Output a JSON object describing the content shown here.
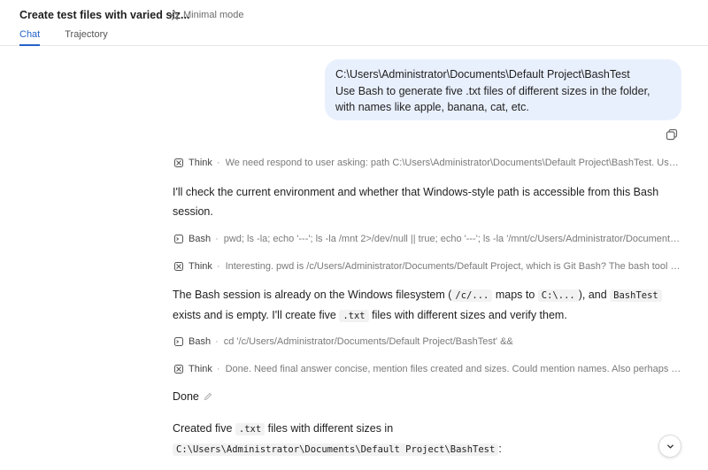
{
  "header": {
    "title": "Create test files with varied siz...",
    "minimal_mode": "Minimal mode",
    "tabs": [
      {
        "label": "Chat",
        "active": true
      },
      {
        "label": "Trajectory",
        "active": false
      }
    ]
  },
  "user_message": {
    "line1": "C:\\Users\\Administrator\\Documents\\Default Project\\BashTest",
    "line2": "Use Bash to generate five .txt files of different sizes in the folder, with names like apple, banana, cat, etc."
  },
  "steps": [
    {
      "kind": "Think",
      "text": "We need respond to user asking: path C:\\Users\\Administrator\\Documents\\Default Project\\BashTest. Use Bash to generate five .txt files"
    },
    {
      "kind": "Bash",
      "text": "pwd; ls -la; echo '---'; ls -la /mnt 2>/dev/null || true; echo '---'; ls -la '/mnt/c/Users/Administrator/Documents/Default Project'"
    },
    {
      "kind": "Think",
      "text": "Interesting. pwd is /c/Users/Administrator/Documents/Default Project, which is Git Bash? The bash tool may run in Git Bash"
    },
    {
      "kind": "Bash",
      "text": "cd '/c/Users/Administrator/Documents/Default Project/BashTest' &&"
    },
    {
      "kind": "Think",
      "text": "Done. Need final answer concise, mention files created and sizes. Could mention names. Also perhaps note the path mapping"
    }
  ],
  "assistant": {
    "para1": "I'll check the current environment and whether that Windows-style path is accessible from this Bash session.",
    "para2": {
      "t1": "The Bash session is already on the Windows filesystem (",
      "c1": "/c/...",
      "t2": " maps to ",
      "c2": "C:\\...",
      "t3": "), and ",
      "c3": "BashTest",
      "t4": " exists and is empty. I'll create five ",
      "c4": ".txt",
      "t5": " files with different sizes and verify them."
    },
    "done": "Done",
    "final": {
      "t1": "Created five ",
      "c1": ".txt",
      "t2": " files with different sizes in",
      "c2": "C:\\Users\\Administrator\\Documents\\Default Project\\BashTest",
      "t3": ":"
    }
  }
}
